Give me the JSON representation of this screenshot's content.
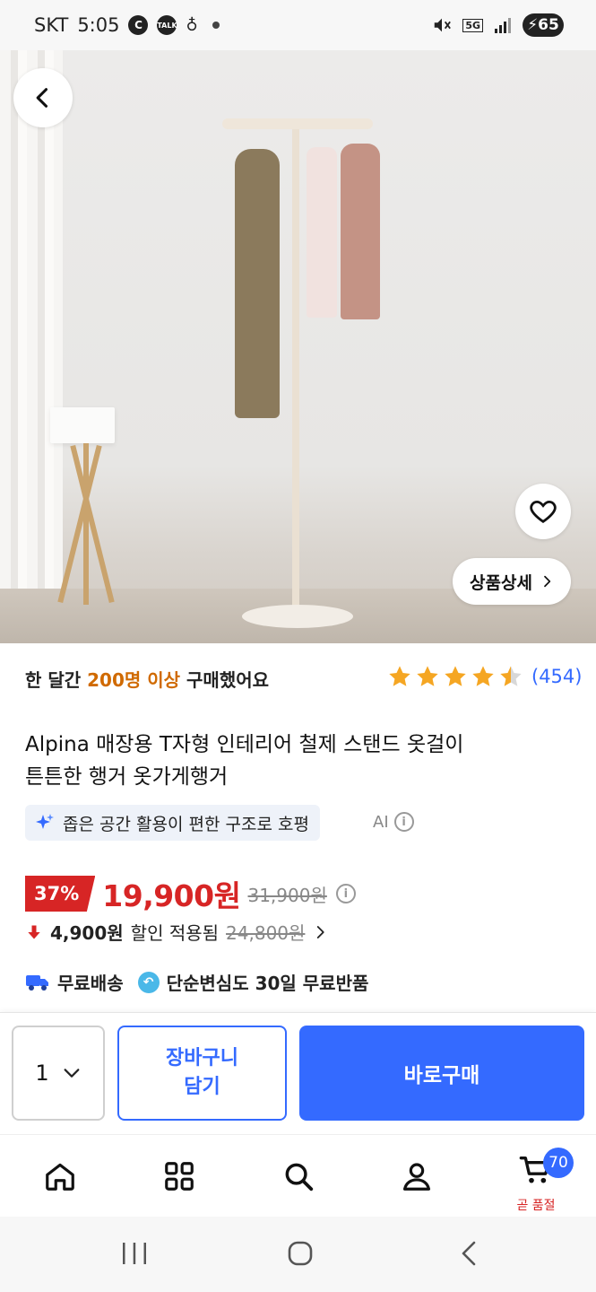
{
  "status_bar": {
    "carrier": "SKT",
    "time": "5:05",
    "icon_c": "C",
    "icon_talk": "TALK",
    "network": "5G",
    "battery": "65"
  },
  "product": {
    "purchase_prefix": "한 달간 ",
    "purchase_highlight": "200명 이상",
    "purchase_suffix": " 구매했어요",
    "rating": 4.5,
    "review_count": "(454)",
    "title_line1": "Alpina 매장용 T자형 인테리어 철제 스탠드 옷걸이",
    "title_line2": "튼튼한 행거 옷가게행거",
    "ai_summary": "좁은 공간 활용이 편한 구조로 호평",
    "ai_label": "AI",
    "discount_badge": "37%",
    "price": "19,900원",
    "original_price": "31,900원",
    "coupon_amount": "4,900원",
    "coupon_text": "할인 적용됨",
    "coupon_final": "24,800원",
    "shipping": "무료배송",
    "returns": "단순변심도 30일 무료반품"
  },
  "hero": {
    "detail_button": "상품상세",
    "image_count": 10,
    "active_index": 0
  },
  "purchase_bar": {
    "quantity": "1",
    "cart_button": "장바구니\n담기",
    "buy_button": "바로구매"
  },
  "bottom_nav": {
    "cart_badge": "70",
    "cart_label": "곧 품절"
  },
  "colors": {
    "accent_blue": "#346aff",
    "price_red": "#d72525",
    "highlight_orange": "#d06a00",
    "star": "#f5a623"
  }
}
